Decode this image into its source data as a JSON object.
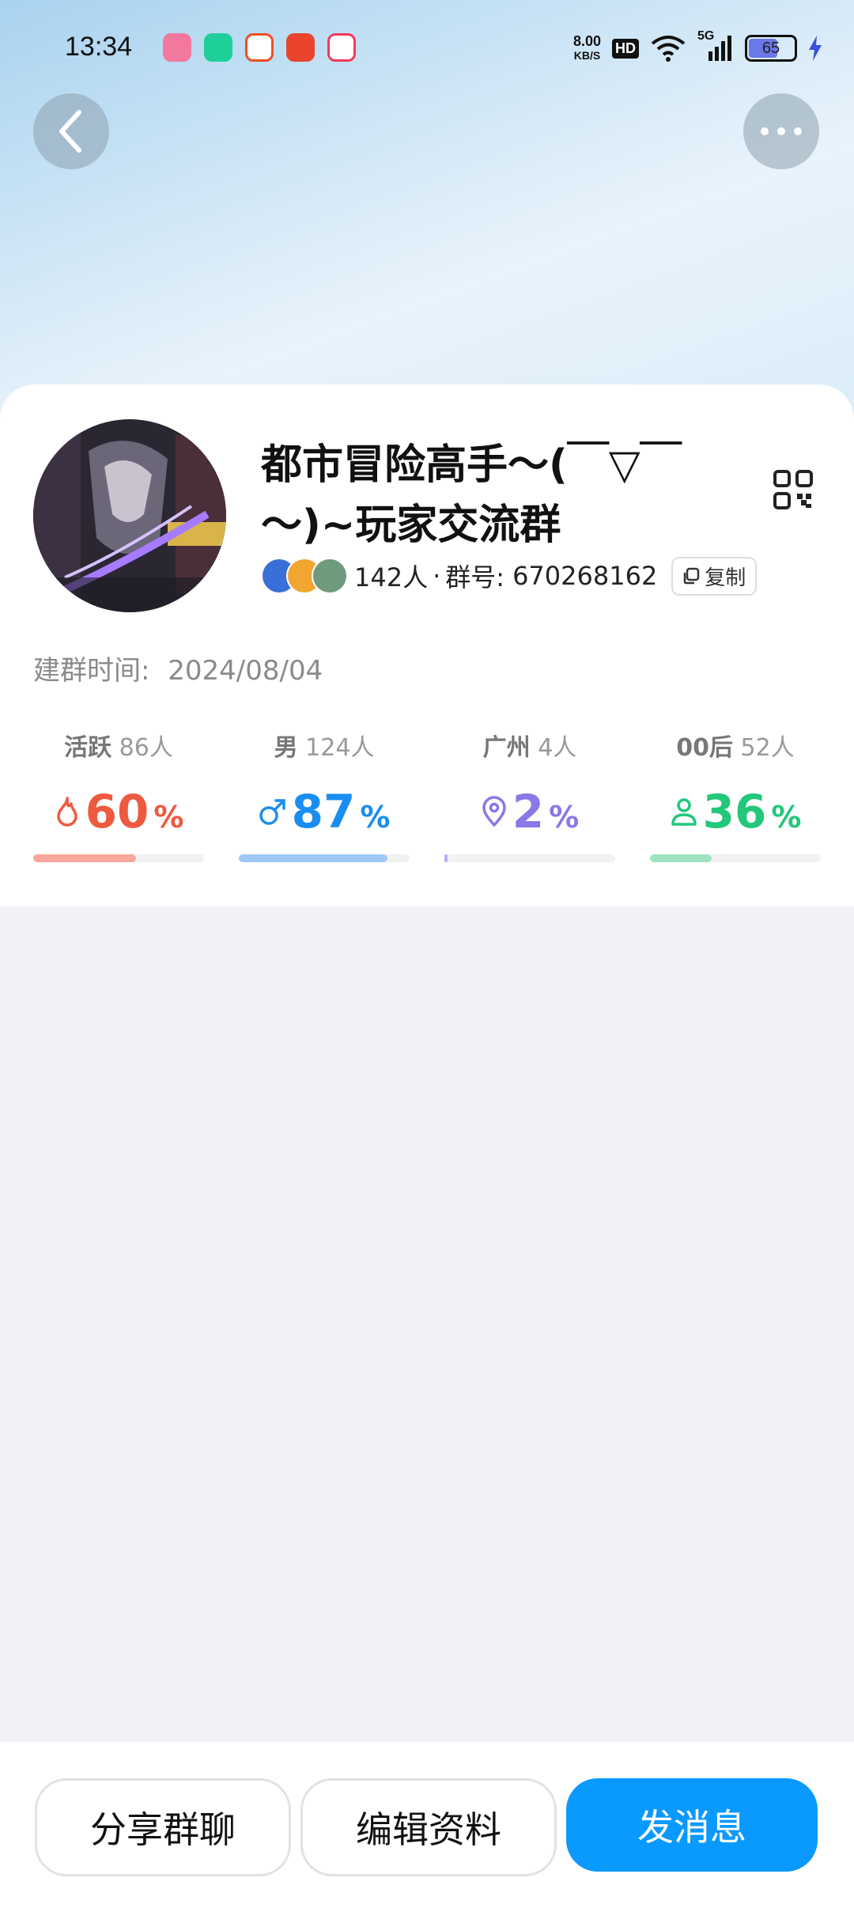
{
  "status_bar": {
    "time": "13:34",
    "net_speed": "8.00",
    "net_unit": "KB/S",
    "hd": "HD",
    "signal": "5G",
    "battery": "65"
  },
  "group": {
    "name": "都市冒险高手～(￣▽￣～)~玩家交流群",
    "member_count": "142人",
    "separator": "·",
    "id_label": "群号:",
    "id_value": "670268162",
    "copy_label": "复制",
    "created_label": "建群时间:",
    "created_date": "2024/08/04"
  },
  "stats": [
    {
      "label": "活跃",
      "count": "86人",
      "value": "60",
      "unit": "%",
      "fill": 0.6,
      "color": "#ee5a3f",
      "bar_color": "#f6a79a",
      "icon": "flame-icon"
    },
    {
      "label": "男",
      "count": "124人",
      "value": "87",
      "unit": "%",
      "fill": 0.87,
      "color": "#1a8ef0",
      "bar_color": "#9fc9f4",
      "icon": "male-icon"
    },
    {
      "label": "广州",
      "count": "4人",
      "value": "2",
      "unit": "%",
      "fill": 0.02,
      "color": "#8a78e6",
      "bar_color": "#b9aef0",
      "icon": "location-icon"
    },
    {
      "label": "00后",
      "count": "52人",
      "value": "36",
      "unit": "%",
      "fill": 0.36,
      "color": "#22c77a",
      "bar_color": "#9fe2c1",
      "icon": "person-icon"
    }
  ],
  "actions": {
    "share": "分享群聊",
    "edit": "编辑资料",
    "send": "发消息"
  }
}
